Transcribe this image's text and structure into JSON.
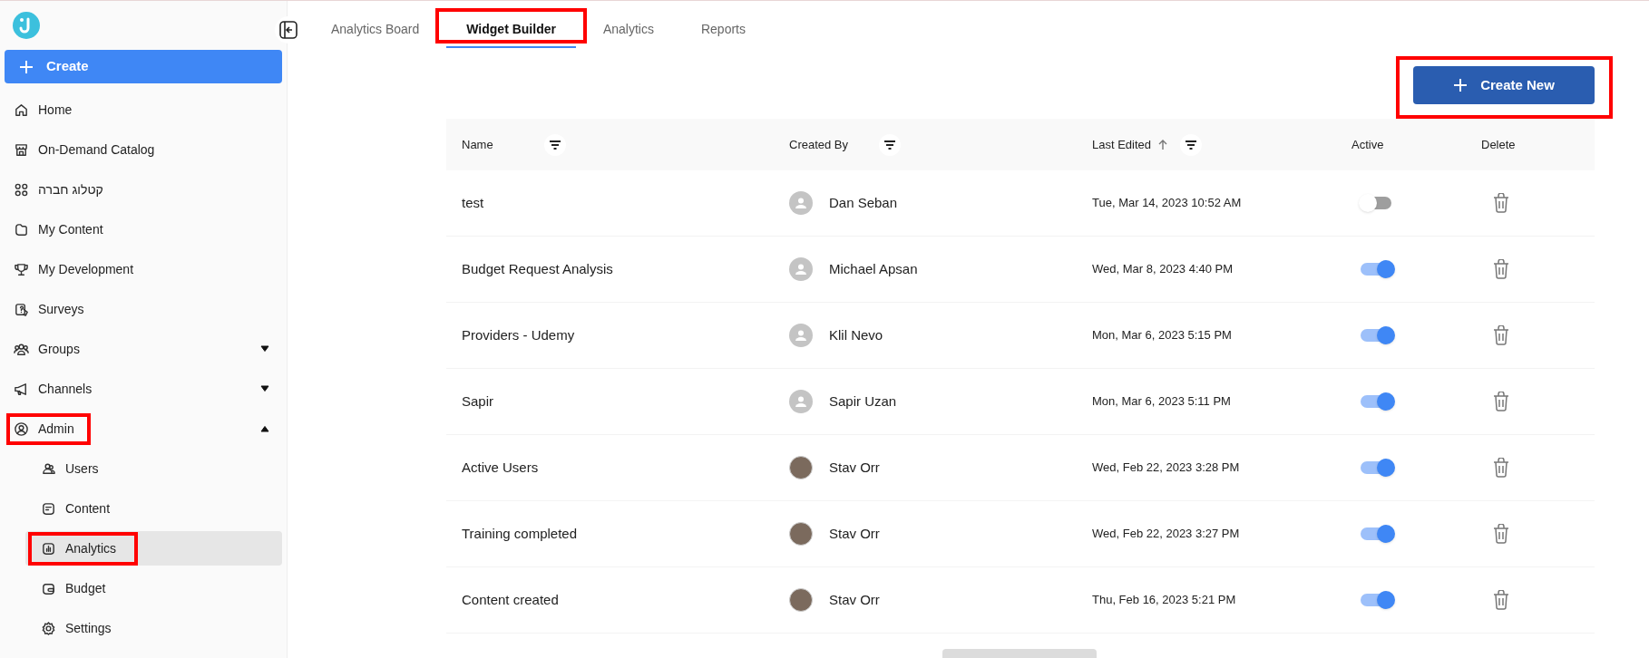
{
  "sidebar": {
    "create_button": "Create",
    "items": [
      {
        "label": "Home",
        "selected": false
      },
      {
        "label": "On-Demand Catalog",
        "selected": false
      },
      {
        "label": "קטלוג חברה",
        "selected": false
      },
      {
        "label": "My Content",
        "selected": false
      },
      {
        "label": "My Development",
        "selected": false
      },
      {
        "label": "Surveys",
        "selected": false
      },
      {
        "label": "Groups",
        "selected": false,
        "expanded": false,
        "highlighted": false
      },
      {
        "label": "Channels",
        "selected": false,
        "expanded": false,
        "highlighted": false
      },
      {
        "label": "Admin",
        "selected": false,
        "expanded": true,
        "highlighted": true,
        "children": [
          {
            "label": "Users",
            "selected": false,
            "highlighted": false
          },
          {
            "label": "Content",
            "selected": false,
            "highlighted": false
          },
          {
            "label": "Analytics",
            "selected": true,
            "highlighted": true
          },
          {
            "label": "Budget",
            "selected": false,
            "highlighted": false
          },
          {
            "label": "Settings",
            "selected": false,
            "highlighted": false
          }
        ]
      }
    ]
  },
  "tabs": [
    {
      "label": "Analytics Board",
      "selected": false,
      "highlighted": false
    },
    {
      "label": "Widget Builder",
      "selected": true,
      "highlighted": true
    },
    {
      "label": "Analytics",
      "selected": false,
      "highlighted": false
    },
    {
      "label": "Reports",
      "selected": false,
      "highlighted": false
    }
  ],
  "create_new_button": {
    "label": "Create New",
    "highlighted": true
  },
  "table": {
    "columns": [
      "Name",
      "Created By",
      "Last Edited",
      "Active",
      "Delete"
    ],
    "rows": [
      {
        "name": "test",
        "created_by": "Dan Seban",
        "has_photo": false,
        "last_edited": "Tue, Mar 14, 2023 10:52 AM",
        "active": false
      },
      {
        "name": "Budget Request Analysis",
        "created_by": "Michael Apsan",
        "has_photo": false,
        "last_edited": "Wed, Mar 8, 2023 4:40 PM",
        "active": true
      },
      {
        "name": "Providers - Udemy",
        "created_by": "Klil Nevo",
        "has_photo": false,
        "last_edited": "Mon, Mar 6, 2023 5:15 PM",
        "active": true
      },
      {
        "name": "Sapir",
        "created_by": "Sapir Uzan",
        "has_photo": false,
        "last_edited": "Mon, Mar 6, 2023 5:11 PM",
        "active": true
      },
      {
        "name": "Active Users",
        "created_by": "Stav Orr",
        "has_photo": true,
        "last_edited": "Wed, Feb 22, 2023 3:28 PM",
        "active": true
      },
      {
        "name": "Training completed",
        "created_by": "Stav Orr",
        "has_photo": true,
        "last_edited": "Wed, Feb 22, 2023 3:27 PM",
        "active": true
      },
      {
        "name": "Content created",
        "created_by": "Stav Orr",
        "has_photo": true,
        "last_edited": "Thu, Feb 16, 2023 5:21 PM",
        "active": true
      }
    ]
  }
}
